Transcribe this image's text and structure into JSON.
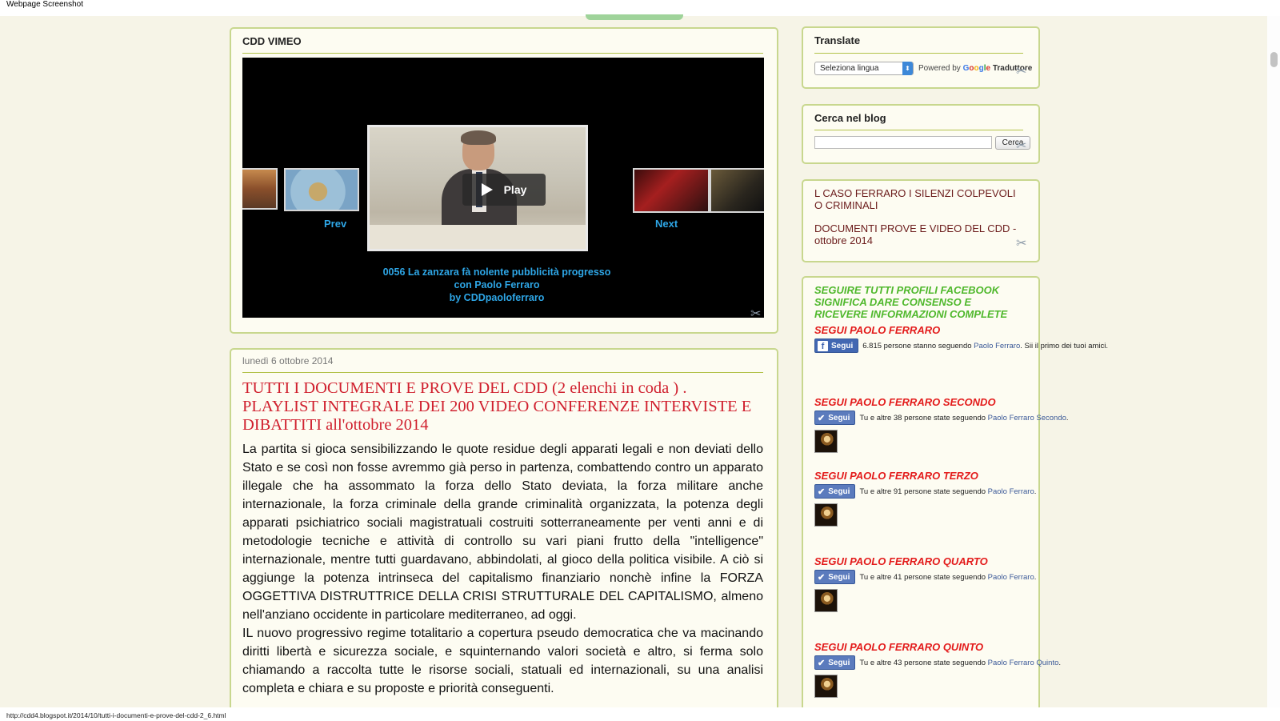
{
  "window": {
    "title": "Webpage Screenshot"
  },
  "vimeo": {
    "title": "CDD VIMEO",
    "play_label": "Play",
    "prev_label": "Prev",
    "next_label": "Next",
    "caption_line1": "0056 La zanzara fà nolente pubblicità progresso",
    "caption_line2": "con Paolo Ferraro",
    "caption_by": "by CDDpaoloferraro"
  },
  "post": {
    "date": "lunedì 6 ottobre 2014",
    "title": "TUTTI I DOCUMENTI E PROVE DEL CDD (2 elenchi in coda ) . PLAYLIST INTEGRALE DEI 200 VIDEO CONFERENZE INTERVISTE E DIBATTITI all'ottobre 2014",
    "paragraph1": "La partita si gioca sensibilizzando le quote residue degli apparati legali e non deviati dello Stato e se così non fosse avremmo già perso in partenza,  combattendo contro un apparato illegale che ha assommato la forza dello Stato deviata, la forza militare anche internazionale, la forza criminale della grande criminalità organizzata, la potenza degli apparati psichiatrico sociali magistratuali costruiti sotterraneamente per venti anni e di metodologie  tecniche e attività di controllo su vari piani frutto della \"intelligence\" internazionale, mentre tutti guardavano,  abbindolati, al gioco della politica visibile. A ciò si aggiunge la potenza intrinseca del capitalismo finanziario nonchè infine la FORZA OGGETTIVA DISTRUTTRICE  DELLA CRISI STRUTTURALE DEL CAPITALISMO, almeno nell'anziano occidente in particolare mediterraneo,  ad oggi.",
    "paragraph2": "IL nuovo progressivo regime totalitario a copertura pseudo democratica che va macinando diritti libertà e sicurezza sociale, e squinternando valori società e altro, si ferma solo chiamando a raccolta tutte le risorse sociali, statuali ed internazionali,  su una analisi completa e chiara e su proposte e priorità conseguenti."
  },
  "sidebar": {
    "translate": {
      "title": "Translate",
      "select_value": "Seleziona lingua",
      "powered_by": "Powered by",
      "google_g": "G",
      "google_o1": "o",
      "google_o2": "o",
      "google_g2": "g",
      "google_l": "l",
      "google_e": "e",
      "translator": "Traduttore"
    },
    "search": {
      "title": "Cerca nel blog",
      "input_value": "",
      "button_label": "Cerca"
    },
    "links": [
      {
        "label": "L CASO FERRARO I SILENZI COLPEVOLI O CRIMINALI"
      },
      {
        "label": "DOCUMENTI PROVE E VIDEO DEL CDD - ottobre 2014"
      }
    ],
    "facebook": {
      "intro": "SEGUIRE TUTTI PROFILI FACEBOOK SIGNIFICA DARE CONSENSO E RICEVERE INFORMAZIONI COMPLETE",
      "follow_label": "Segui",
      "profiles": [
        {
          "heading": "SEGUI PAOLO FERRARO",
          "text": "6.815 persone stanno seguendo",
          "name": "Paolo Ferraro",
          "suffix": ". Sii il primo dei tuoi amici."
        },
        {
          "heading": "SEGUI PAOLO FERRARO SECONDO",
          "text": "Tu e altre 38 persone state seguendo",
          "name": "Paolo Ferraro Secondo",
          "suffix": "."
        },
        {
          "heading": "SEGUI PAOLO FERRARO TERZO",
          "text": "Tu e altre 91 persone state seguendo",
          "name": "Paolo Ferraro",
          "suffix": "."
        },
        {
          "heading": "SEGUI PAOLO FERRARO QUARTO",
          "text": "Tu e altre 41 persone state seguendo",
          "name": "Paolo Ferraro",
          "suffix": "."
        },
        {
          "heading": "SEGUI PAOLO FERRARO QUINTO",
          "text": "Tu e altre 43 persone state seguendo",
          "name": "Paolo Ferraro Quinto",
          "suffix": "."
        }
      ]
    }
  },
  "status_bar": {
    "url": "http://cdd4.blogspot.it/2014/10/tutti-i-documenti-e-prove-del-cdd-2_6.html"
  },
  "icons": {
    "tool": "wrench-screwdriver-icon",
    "play": "play-icon",
    "check": "check-icon",
    "facebook": "facebook-logo-icon"
  },
  "colors": {
    "background": "#f6f4e7",
    "panel_border": "#c8d78e",
    "title_red": "#d0202e",
    "link_blue": "#2ea6e6",
    "intro_green": "#4fb82c",
    "fb_blue": "#4267b2"
  }
}
